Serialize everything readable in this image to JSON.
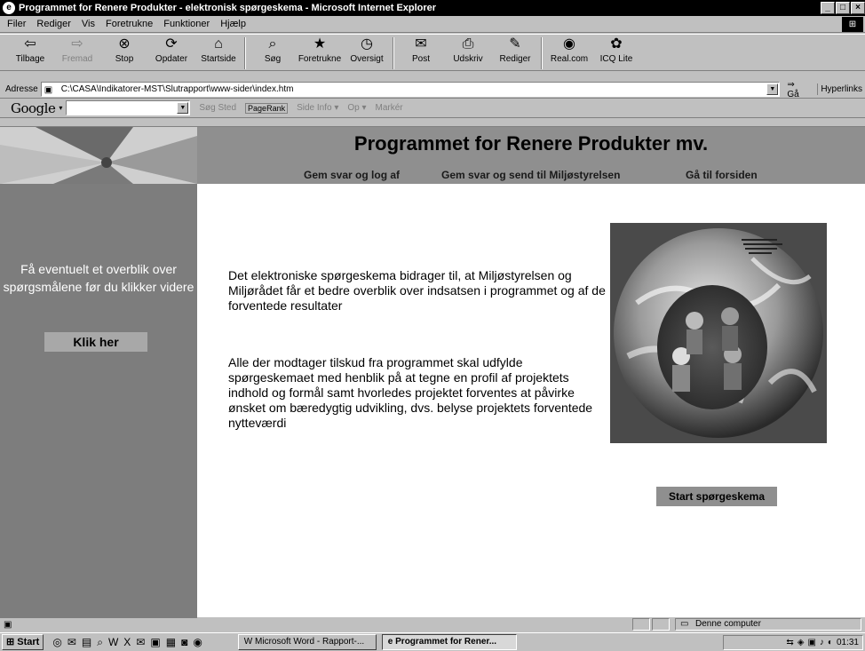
{
  "window": {
    "title": "Programmet for Renere Produkter - elektronisk spørgeskema - Microsoft Internet Explorer",
    "btn_min": "_",
    "btn_max": "□",
    "btn_close": "×"
  },
  "menu": [
    "Filer",
    "Rediger",
    "Vis",
    "Foretrukne",
    "Funktioner",
    "Hjælp"
  ],
  "toolbar": [
    {
      "label": "Tilbage",
      "icon": "⇦",
      "enabled": true
    },
    {
      "label": "Fremad",
      "icon": "⇨",
      "enabled": false
    },
    {
      "label": "Stop",
      "icon": "⊗",
      "enabled": true
    },
    {
      "label": "Opdater",
      "icon": "⟳",
      "enabled": true
    },
    {
      "label": "Startside",
      "icon": "⌂",
      "enabled": true
    },
    {
      "label": "Søg",
      "icon": "⌕",
      "enabled": true
    },
    {
      "label": "Foretrukne",
      "icon": "★",
      "enabled": true
    },
    {
      "label": "Oversigt",
      "icon": "◷",
      "enabled": true
    },
    {
      "label": "Post",
      "icon": "✉",
      "enabled": true
    },
    {
      "label": "Udskriv",
      "icon": "⎙",
      "enabled": true
    },
    {
      "label": "Rediger",
      "icon": "✎",
      "enabled": true
    },
    {
      "label": "Real.com",
      "icon": "◉",
      "enabled": true
    },
    {
      "label": "ICQ Lite",
      "icon": "✿",
      "enabled": true
    }
  ],
  "address": {
    "label": "Adresse",
    "value": "C:\\CASA\\Indikatorer-MST\\Slutrapport\\www-sider\\index.htm",
    "go": "Gå",
    "links": "Hyperlinks"
  },
  "google": {
    "logo": "Google",
    "items": [
      "Søg Sted",
      "PageRank",
      "Side Info ▾",
      "Op ▾",
      "Markér"
    ]
  },
  "page": {
    "title": "Programmet for Renere Produkter mv.",
    "nav": [
      "Gem svar og log af",
      "Gem svar og send til Miljøstyrelsen",
      "Gå til forsiden"
    ],
    "sidebar_text": "Få eventuelt et overblik over spørgsmålene før du klikker videre",
    "klik_button": "Klik her",
    "paragraph1": "Det elektroniske spørgeskema bidrager til, at Miljøstyrelsen og Miljørådet får et bedre overblik over indsatsen i programmet og af de forventede resultater",
    "paragraph2": "Alle der modtager tilskud fra programmet skal udfylde spørgeskemaet med henblik på at tegne en profil af projektets indhold og formål samt hvorledes projektet forventes at påvirke ønsket om bæredygtig udvikling, dvs. belyse projektets forventede nytteværdi",
    "start_button": "Start spørgeskema"
  },
  "status": {
    "zone": "Denne computer"
  },
  "taskbar": {
    "start": "Start",
    "tasks": [
      "Microsoft Word - Rapport-...",
      "Programmet for Rener..."
    ],
    "clock": "01:31"
  }
}
